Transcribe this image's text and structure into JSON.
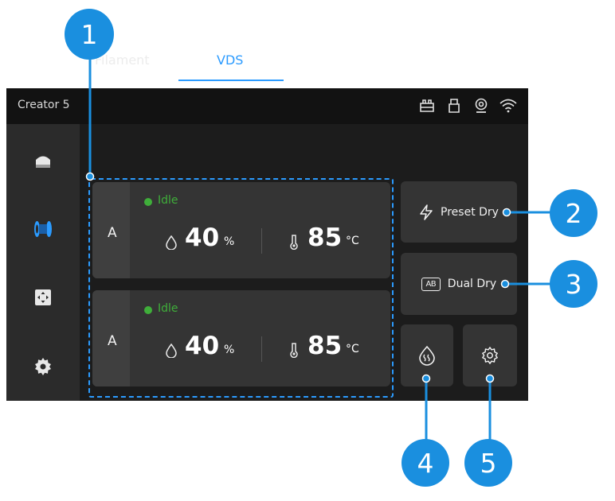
{
  "topbar": {
    "title": "Creator 5",
    "status_icons": [
      "filament-box-icon",
      "usb-icon",
      "camera-icon",
      "wifi-icon"
    ]
  },
  "sidebar": {
    "items": [
      {
        "icon": "home-icon",
        "active": false
      },
      {
        "icon": "filament-spool-icon",
        "active": true
      },
      {
        "icon": "move-axes-icon",
        "active": false
      },
      {
        "icon": "settings-gear-icon",
        "active": false
      }
    ]
  },
  "tabs": [
    {
      "label": "Filament",
      "active": false
    },
    {
      "label": "VDS",
      "active": true
    }
  ],
  "slots": [
    {
      "letter": "A",
      "status": "Idle",
      "humidity": "40",
      "humidity_unit": "%",
      "temperature": "85",
      "temperature_unit": "°C"
    },
    {
      "letter": "A",
      "status": "Idle",
      "humidity": "40",
      "humidity_unit": "%",
      "temperature": "85",
      "temperature_unit": "°C"
    }
  ],
  "actions": {
    "preset_dry": {
      "label": "Preset Dry",
      "icon": "lightning-icon"
    },
    "dual_dry": {
      "label": "Dual Dry",
      "icon": "ab-icon",
      "icon_text": "AB"
    },
    "humidity": {
      "icon": "humidity-icon"
    },
    "settings": {
      "icon": "gear-icon"
    }
  },
  "callouts": [
    "1",
    "2",
    "3",
    "4",
    "5"
  ],
  "colors": {
    "accent": "#2b9bff",
    "callout": "#1a8fdf",
    "idle": "#3fae3a",
    "screen": "#1c1c1c",
    "card": "#343434"
  }
}
